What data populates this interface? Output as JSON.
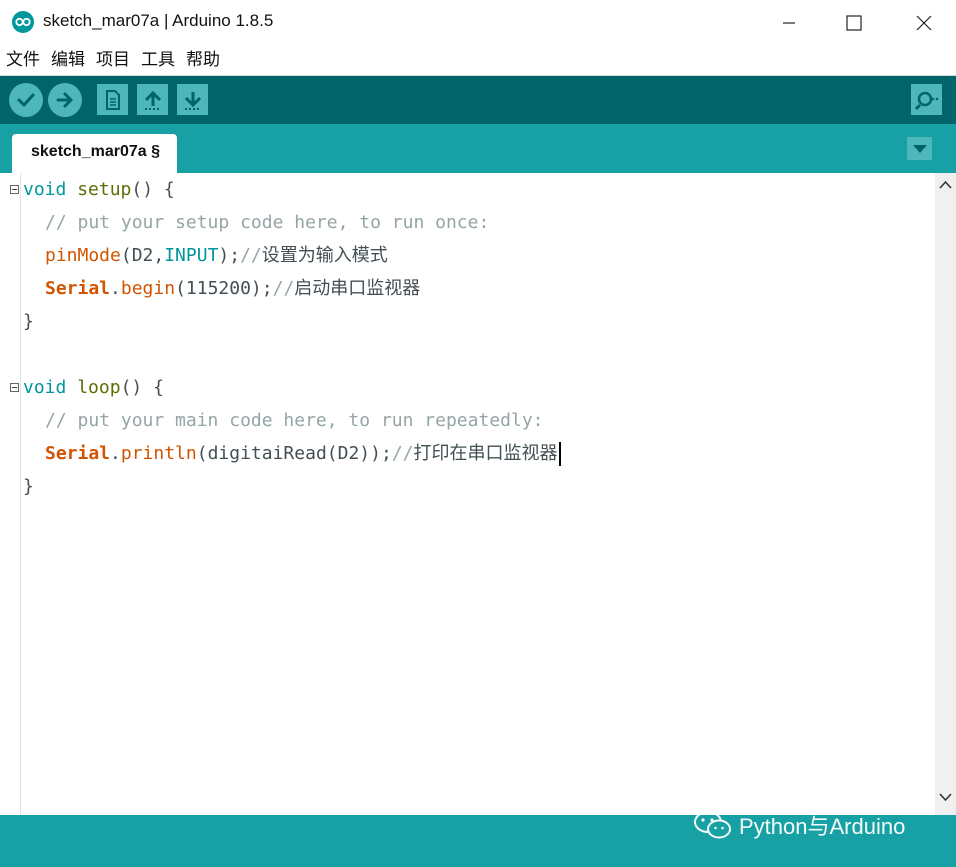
{
  "window": {
    "title": "sketch_mar07a | Arduino 1.8.5",
    "app_icon": "arduino-infinity-icon",
    "controls": [
      "minimize-icon",
      "maximize-icon",
      "close-icon"
    ]
  },
  "menubar": {
    "items": [
      "文件",
      "编辑",
      "项目",
      "工具",
      "帮助"
    ]
  },
  "toolbar": {
    "buttons": [
      "verify-icon",
      "upload-icon",
      "new-icon",
      "open-icon",
      "save-icon"
    ],
    "serial_monitor": "serial-monitor-icon"
  },
  "tabs": {
    "items": [
      {
        "label": "sketch_mar07a §"
      }
    ],
    "menu_icon": "tab-menu-triangle-icon"
  },
  "editor": {
    "lines": {
      "l1": {
        "type": "void",
        "fn": "setup",
        "rest": "() {"
      },
      "l2": {
        "comment": "// put your setup code here, to run once:"
      },
      "l3": {
        "call": "pinMode",
        "open": "(D2,",
        "const": "INPUT",
        "close": ");",
        "comment": "//",
        "comment_cjk": "设置为输入模式"
      },
      "l4": {
        "obj": "Serial",
        "dot": ".",
        "call": "begin",
        "args": "(115200);",
        "comment": "//",
        "comment_cjk": "启动串口监视器"
      },
      "l5": {
        "text": "}"
      },
      "l7": {
        "type": "void",
        "fn": "loop",
        "rest": "() {"
      },
      "l8": {
        "comment": "// put your main code here, to run repeatedly:"
      },
      "l9": {
        "obj": "Serial",
        "dot": ".",
        "call": "println",
        "args": "(digitaiRead(D2));",
        "comment": "//",
        "comment_cjk": "打印在串口监视器"
      },
      "l10": {
        "text": "}"
      }
    }
  },
  "console": {
    "watermark": "Python与Arduino",
    "watermark_icon": "wechat-icon"
  },
  "colors": {
    "toolbar": "#006468",
    "tabbar": "#17a1a5",
    "button": "#4db7bb",
    "keyword": "#00979c",
    "function": "#5e6d03",
    "library": "#d35400",
    "comment": "#95a5a6"
  }
}
